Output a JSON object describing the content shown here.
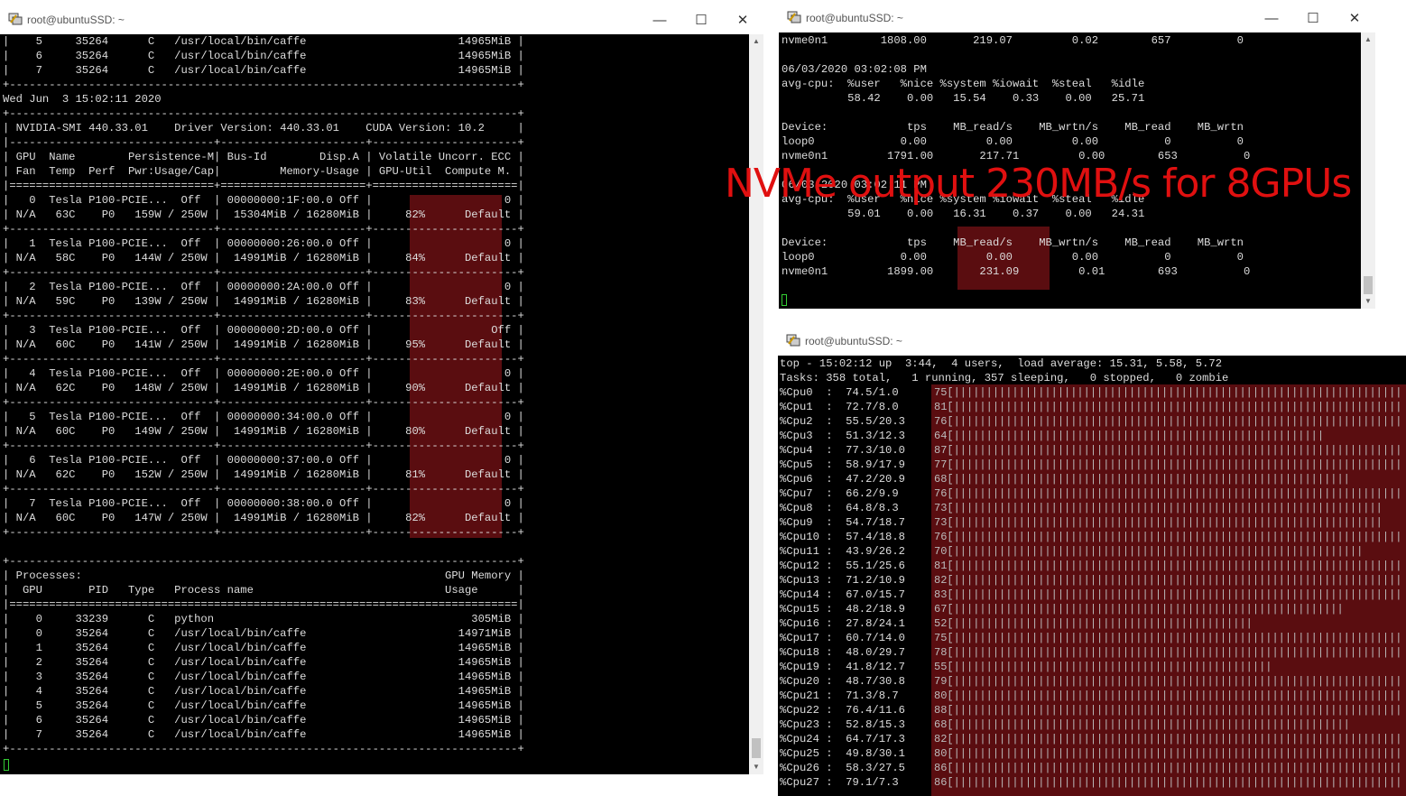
{
  "left_window": {
    "title": "root@ubuntuSSD: ~",
    "lines": [
      "|    5     35264      C   /usr/local/bin/caffe                       14965MiB |",
      "|    6     35264      C   /usr/local/bin/caffe                       14965MiB |",
      "|    7     35264      C   /usr/local/bin/caffe                       14965MiB |",
      "+-----------------------------------------------------------------------------+",
      "Wed Jun  3 15:02:11 2020",
      "+-----------------------------------------------------------------------------+",
      "| NVIDIA-SMI 440.33.01    Driver Version: 440.33.01    CUDA Version: 10.2     |",
      "|-------------------------------+----------------------+----------------------+",
      "| GPU  Name        Persistence-M| Bus-Id        Disp.A | Volatile Uncorr. ECC |",
      "| Fan  Temp  Perf  Pwr:Usage/Cap|         Memory-Usage | GPU-Util  Compute M. |",
      "|===============================+======================+======================|",
      "|   0  Tesla P100-PCIE...  Off  | 00000000:1F:00.0 Off |                    0 |",
      "| N/A   63C    P0   159W / 250W |  15304MiB / 16280MiB |     82%      Default |",
      "+-------------------------------+----------------------+----------------------+",
      "|   1  Tesla P100-PCIE...  Off  | 00000000:26:00.0 Off |                    0 |",
      "| N/A   58C    P0   144W / 250W |  14991MiB / 16280MiB |     84%      Default |",
      "+-------------------------------+----------------------+----------------------+",
      "|   2  Tesla P100-PCIE...  Off  | 00000000:2A:00.0 Off |                    0 |",
      "| N/A   59C    P0   139W / 250W |  14991MiB / 16280MiB |     83%      Default |",
      "+-------------------------------+----------------------+----------------------+",
      "|   3  Tesla P100-PCIE...  Off  | 00000000:2D:00.0 Off |                  Off |",
      "| N/A   60C    P0   141W / 250W |  14991MiB / 16280MiB |     95%      Default |",
      "+-------------------------------+----------------------+----------------------+",
      "|   4  Tesla P100-PCIE...  Off  | 00000000:2E:00.0 Off |                    0 |",
      "| N/A   62C    P0   148W / 250W |  14991MiB / 16280MiB |     90%      Default |",
      "+-------------------------------+----------------------+----------------------+",
      "|   5  Tesla P100-PCIE...  Off  | 00000000:34:00.0 Off |                    0 |",
      "| N/A   60C    P0   149W / 250W |  14991MiB / 16280MiB |     80%      Default |",
      "+-------------------------------+----------------------+----------------------+",
      "|   6  Tesla P100-PCIE...  Off  | 00000000:37:00.0 Off |                    0 |",
      "| N/A   62C    P0   152W / 250W |  14991MiB / 16280MiB |     81%      Default |",
      "+-------------------------------+----------------------+----------------------+",
      "|   7  Tesla P100-PCIE...  Off  | 00000000:38:00.0 Off |                    0 |",
      "| N/A   60C    P0   147W / 250W |  14991MiB / 16280MiB |     82%      Default |",
      "+-------------------------------+----------------------+----------------------+",
      "",
      "+-----------------------------------------------------------------------------+",
      "| Processes:                                                       GPU Memory |",
      "|  GPU       PID   Type   Process name                             Usage      |",
      "|=============================================================================|",
      "|    0     33239      C   python                                       305MiB |",
      "|    0     35264      C   /usr/local/bin/caffe                       14971MiB |",
      "|    1     35264      C   /usr/local/bin/caffe                       14965MiB |",
      "|    2     35264      C   /usr/local/bin/caffe                       14965MiB |",
      "|    3     35264      C   /usr/local/bin/caffe                       14965MiB |",
      "|    4     35264      C   /usr/local/bin/caffe                       14965MiB |",
      "|    5     35264      C   /usr/local/bin/caffe                       14965MiB |",
      "|    6     35264      C   /usr/local/bin/caffe                       14965MiB |",
      "|    7     35264      C   /usr/local/bin/caffe                       14965MiB |",
      "+-----------------------------------------------------------------------------+"
    ]
  },
  "iostat_window": {
    "title": "root@ubuntuSSD: ~",
    "lines": [
      "nvme0n1        1808.00       219.07         0.02        657          0",
      "",
      "06/03/2020 03:02:08 PM",
      "avg-cpu:  %user   %nice %system %iowait  %steal   %idle",
      "          58.42    0.00   15.54    0.33    0.00   25.71",
      "",
      "Device:            tps    MB_read/s    MB_wrtn/s    MB_read    MB_wrtn",
      "loop0             0.00         0.00         0.00          0          0",
      "nvme0n1         1791.00       217.71         0.00        653          0",
      "",
      "06/03/2020 03:02:11 PM",
      "avg-cpu:  %user   %nice %system %iowait  %steal   %idle",
      "          59.01    0.00   16.31    0.37    0.00   24.31",
      "",
      "Device:            tps    MB_read/s    MB_wrtn/s    MB_read    MB_wrtn",
      "loop0             0.00         0.00         0.00          0          0",
      "nvme0n1         1899.00       231.09         0.01        693          0"
    ]
  },
  "top_window": {
    "title": "root@ubuntuSSD: ~",
    "header_lines": [
      "top - 15:02:12 up  3:44,  4 users,  load average: 15.31, 5.58, 5.72",
      "Tasks: 358 total,   1 running, 357 sleeping,   0 stopped,   0 zombie"
    ],
    "cpus": [
      {
        "label": "%Cpu0  :  74.5/1.0",
        "pct": "75",
        "fill": 1.0
      },
      {
        "label": "%Cpu1  :  72.7/8.0",
        "pct": "81",
        "fill": 1.0
      },
      {
        "label": "%Cpu2  :  55.5/20.3",
        "pct": "76",
        "fill": 1.0
      },
      {
        "label": "%Cpu3  :  51.3/12.3",
        "pct": "64",
        "fill": 0.84
      },
      {
        "label": "%Cpu4  :  77.3/10.0",
        "pct": "87",
        "fill": 1.0
      },
      {
        "label": "%Cpu5  :  58.9/17.9",
        "pct": "77",
        "fill": 1.0
      },
      {
        "label": "%Cpu6  :  47.2/20.9",
        "pct": "68",
        "fill": 0.9
      },
      {
        "label": "%Cpu7  :  66.2/9.9",
        "pct": "76",
        "fill": 1.0
      },
      {
        "label": "%Cpu8  :  64.8/8.3",
        "pct": "73",
        "fill": 0.96
      },
      {
        "label": "%Cpu9  :  54.7/18.7",
        "pct": "73",
        "fill": 0.96
      },
      {
        "label": "%Cpu10 :  57.4/18.8",
        "pct": "76",
        "fill": 1.0
      },
      {
        "label": "%Cpu11 :  43.9/26.2",
        "pct": "70",
        "fill": 0.92
      },
      {
        "label": "%Cpu12 :  55.1/25.6",
        "pct": "81",
        "fill": 1.0
      },
      {
        "label": "%Cpu13 :  71.2/10.9",
        "pct": "82",
        "fill": 1.0
      },
      {
        "label": "%Cpu14 :  67.0/15.7",
        "pct": "83",
        "fill": 1.0
      },
      {
        "label": "%Cpu15 :  48.2/18.9",
        "pct": "67",
        "fill": 0.88
      },
      {
        "label": "%Cpu16 :  27.8/24.1",
        "pct": "52",
        "fill": 0.68
      },
      {
        "label": "%Cpu17 :  60.7/14.0",
        "pct": "75",
        "fill": 1.0
      },
      {
        "label": "%Cpu18 :  48.0/29.7",
        "pct": "78",
        "fill": 1.0
      },
      {
        "label": "%Cpu19 :  41.8/12.7",
        "pct": "55",
        "fill": 0.72
      },
      {
        "label": "%Cpu20 :  48.7/30.8",
        "pct": "79",
        "fill": 1.0
      },
      {
        "label": "%Cpu21 :  71.3/8.7",
        "pct": "80",
        "fill": 1.0
      },
      {
        "label": "%Cpu22 :  76.4/11.6",
        "pct": "88",
        "fill": 1.0
      },
      {
        "label": "%Cpu23 :  52.8/15.3",
        "pct": "68",
        "fill": 0.9
      },
      {
        "label": "%Cpu24 :  64.7/17.3",
        "pct": "82",
        "fill": 1.0
      },
      {
        "label": "%Cpu25 :  49.8/30.1",
        "pct": "80",
        "fill": 1.0
      },
      {
        "label": "%Cpu26 :  58.3/27.5",
        "pct": "86",
        "fill": 1.0
      },
      {
        "label": "%Cpu27 :  79.1/7.3",
        "pct": "86",
        "fill": 1.0
      }
    ]
  },
  "annotation": "NVMe output 230MB/s for 8GPUs",
  "colors": {
    "highlight": "#5a0d10",
    "annotation": "#e01010",
    "cursor": "#33cc33"
  }
}
